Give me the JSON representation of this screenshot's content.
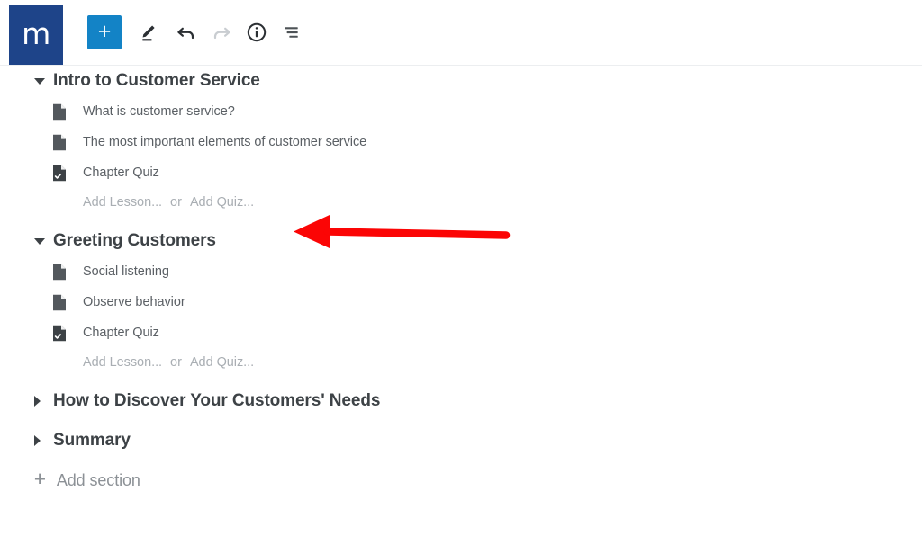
{
  "app": {
    "logo_mark": "m",
    "logo_color": "#1e4489"
  },
  "toolbar": {
    "add_label": "+",
    "add_button_color": "#1383c6",
    "items": [
      {
        "name": "add-icon",
        "label": "+",
        "state": "enabled"
      },
      {
        "name": "edit-pencil-icon",
        "label": "Edit",
        "state": "enabled"
      },
      {
        "name": "undo-icon",
        "label": "Undo",
        "state": "enabled"
      },
      {
        "name": "redo-icon",
        "label": "Redo",
        "state": "disabled"
      },
      {
        "name": "info-icon",
        "label": "Info",
        "state": "enabled"
      },
      {
        "name": "outline-collapse-icon",
        "label": "Collapse all",
        "state": "enabled"
      }
    ]
  },
  "outline": {
    "sections": [
      {
        "title": "Intro to Customer Service",
        "expanded": true,
        "items": [
          {
            "label": "What is customer service?",
            "type": "lesson"
          },
          {
            "label": "The most important elements of customer service",
            "type": "lesson"
          },
          {
            "label": "Chapter Quiz",
            "type": "quiz"
          }
        ],
        "add_lesson_label": "Add Lesson...",
        "or_label": "or",
        "add_quiz_label": "Add Quiz..."
      },
      {
        "title": "Greeting Customers",
        "expanded": true,
        "items": [
          {
            "label": "Social listening",
            "type": "lesson"
          },
          {
            "label": "Observe behavior",
            "type": "lesson"
          },
          {
            "label": "Chapter Quiz",
            "type": "quiz"
          }
        ],
        "add_lesson_label": "Add Lesson...",
        "or_label": "or",
        "add_quiz_label": "Add Quiz..."
      },
      {
        "title": "How to Discover Your Customers' Needs",
        "expanded": false,
        "items": [],
        "add_lesson_label": "",
        "or_label": "",
        "add_quiz_label": ""
      },
      {
        "title": "Summary",
        "expanded": false,
        "items": [],
        "add_lesson_label": "",
        "or_label": "",
        "add_quiz_label": ""
      }
    ],
    "add_section_plus": "+",
    "add_section_label": "Add section"
  },
  "annotation": {
    "type": "arrow",
    "color": "#fb0505",
    "points_to": "Add Quiz...",
    "direction": "left"
  }
}
